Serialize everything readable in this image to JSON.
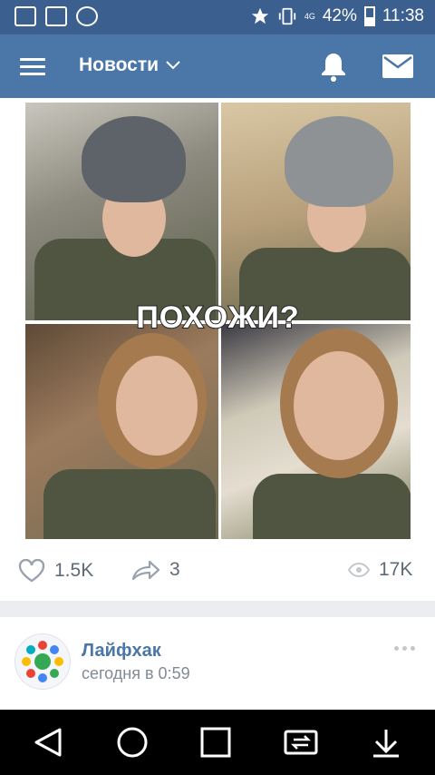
{
  "status_bar": {
    "battery_percent": "42%",
    "time": "11:38",
    "network": "4G",
    "icons": [
      "gallery-icon",
      "w-app-icon",
      "vk-notification-icon",
      "star-icon",
      "vibrate-icon",
      "signal-icon",
      "battery-icon"
    ]
  },
  "header": {
    "title": "Новости",
    "icons": [
      "menu-icon",
      "chevron-down-icon",
      "bell-icon",
      "mail-icon"
    ]
  },
  "post": {
    "image_caption": "ПОХОЖИ?",
    "likes": "1.5K",
    "shares": "3",
    "views": "17K"
  },
  "next_post": {
    "author": "Лайфхак",
    "time": "сегодня в 0:59"
  },
  "nav": {
    "icons": [
      "back-icon",
      "home-icon",
      "recents-icon",
      "swap-icon",
      "download-icon"
    ]
  },
  "colors": {
    "header_bg": "#4a76a8",
    "status_bg": "#3b5f8e",
    "link": "#4a76a8",
    "muted": "#828a95"
  }
}
